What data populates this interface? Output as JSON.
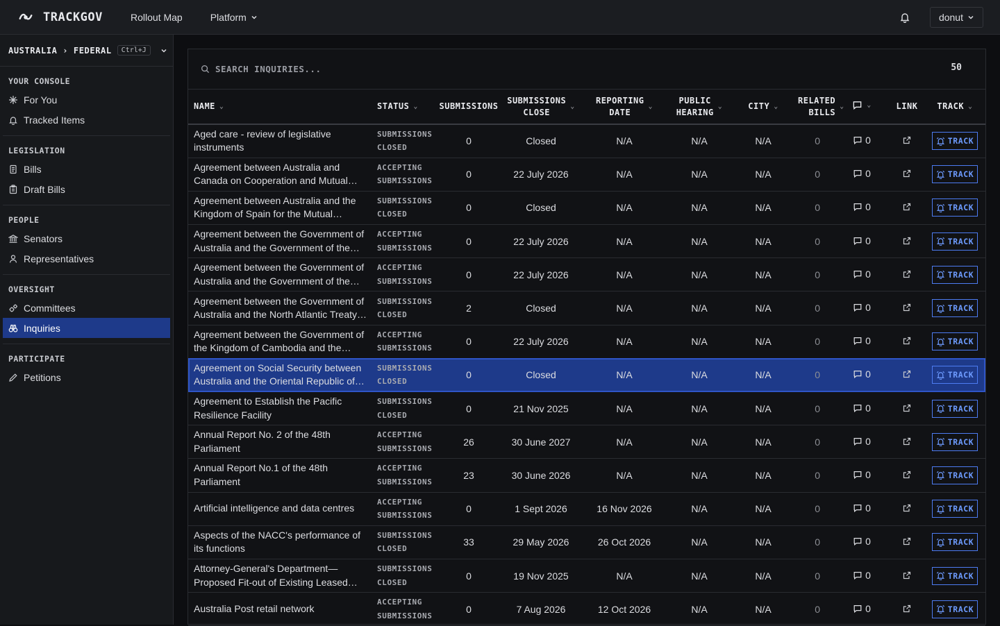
{
  "brand": "TRACKGOV",
  "nav": {
    "rollout_map": "Rollout Map",
    "platform": "Platform"
  },
  "user": "donut",
  "jurisdiction": {
    "label": "AUSTRALIA › FEDERAL",
    "shortcut": "Ctrl+J"
  },
  "sidebar": {
    "sections": [
      {
        "title": "YOUR CONSOLE",
        "items": [
          {
            "label": "For You",
            "icon": "sparkle-icon"
          },
          {
            "label": "Tracked Items",
            "icon": "bell-icon"
          }
        ]
      },
      {
        "title": "LEGISLATION",
        "items": [
          {
            "label": "Bills",
            "icon": "scroll-icon"
          },
          {
            "label": "Draft Bills",
            "icon": "clipboard-icon"
          }
        ]
      },
      {
        "title": "PEOPLE",
        "items": [
          {
            "label": "Senators",
            "icon": "landmark-icon"
          },
          {
            "label": "Representatives",
            "icon": "person-icon"
          }
        ]
      },
      {
        "title": "OVERSIGHT",
        "items": [
          {
            "label": "Committees",
            "icon": "cog-group-icon"
          },
          {
            "label": "Inquiries",
            "icon": "binoculars-icon",
            "active": true
          }
        ]
      },
      {
        "title": "PARTICIPATE",
        "items": [
          {
            "label": "Petitions",
            "icon": "pen-icon"
          }
        ]
      }
    ]
  },
  "search": {
    "placeholder": "SEARCH INQUIRIES...",
    "count": "50"
  },
  "columns": {
    "name": "NAME",
    "status": "STATUS",
    "submissions": "SUBMISSIONS",
    "submissions_close_1": "SUBMISSIONS",
    "submissions_close_2": "CLOSE",
    "reporting_date_1": "REPORTING",
    "reporting_date_2": "DATE",
    "public_hearing_1": "PUBLIC",
    "public_hearing_2": "HEARING",
    "city": "CITY",
    "related_bills_1": "RELATED",
    "related_bills_2": "BILLS",
    "link": "LINK",
    "track": "TRACK"
  },
  "track_label": "TRACK",
  "rows": [
    {
      "name": "Aged care - review of legislative instruments",
      "status1": "SUBMISSIONS",
      "status2": "CLOSED",
      "submissions": "0",
      "close": "Closed",
      "reporting": "N/A",
      "hearing": "N/A",
      "city": "N/A",
      "bills": "0",
      "comments": "0"
    },
    {
      "name": "Agreement between Australia and Canada on Cooperation and Mutual Assistance",
      "status1": "ACCEPTING",
      "status2": "SUBMISSIONS",
      "submissions": "0",
      "close": "22 July 2026",
      "reporting": "N/A",
      "hearing": "N/A",
      "city": "N/A",
      "bills": "0",
      "comments": "0"
    },
    {
      "name": "Agreement between Australia and the Kingdom of Spain for the Mutual Protection",
      "status1": "SUBMISSIONS",
      "status2": "CLOSED",
      "submissions": "0",
      "close": "Closed",
      "reporting": "N/A",
      "hearing": "N/A",
      "city": "N/A",
      "bills": "0",
      "comments": "0"
    },
    {
      "name": "Agreement between the Government of Australia and the Government of the Republic",
      "status1": "ACCEPTING",
      "status2": "SUBMISSIONS",
      "submissions": "0",
      "close": "22 July 2026",
      "reporting": "N/A",
      "hearing": "N/A",
      "city": "N/A",
      "bills": "0",
      "comments": "0"
    },
    {
      "name": "Agreement between the Government of Australia and the Government of the Republic",
      "status1": "ACCEPTING",
      "status2": "SUBMISSIONS",
      "submissions": "0",
      "close": "22 July 2026",
      "reporting": "N/A",
      "hearing": "N/A",
      "city": "N/A",
      "bills": "0",
      "comments": "0"
    },
    {
      "name": "Agreement between the Government of Australia and the North Atlantic Treaty Organization",
      "status1": "SUBMISSIONS",
      "status2": "CLOSED",
      "submissions": "2",
      "close": "Closed",
      "reporting": "N/A",
      "hearing": "N/A",
      "city": "N/A",
      "bills": "0",
      "comments": "0"
    },
    {
      "name": "Agreement between the Government of the Kingdom of Cambodia and the Government",
      "status1": "ACCEPTING",
      "status2": "SUBMISSIONS",
      "submissions": "0",
      "close": "22 July 2026",
      "reporting": "N/A",
      "hearing": "N/A",
      "city": "N/A",
      "bills": "0",
      "comments": "0"
    },
    {
      "name": "Agreement on Social Security between Australia and the Oriental Republic of Uruguay",
      "status1": "SUBMISSIONS",
      "status2": "CLOSED",
      "submissions": "0",
      "close": "Closed",
      "reporting": "N/A",
      "hearing": "N/A",
      "city": "N/A",
      "bills": "0",
      "comments": "0",
      "selected": true
    },
    {
      "name": "Agreement to Establish the Pacific Resilience Facility",
      "status1": "SUBMISSIONS",
      "status2": "CLOSED",
      "submissions": "0",
      "close": "21 Nov 2025",
      "reporting": "N/A",
      "hearing": "N/A",
      "city": "N/A",
      "bills": "0",
      "comments": "0"
    },
    {
      "name": "Annual Report No. 2 of the 48th Parliament",
      "status1": "ACCEPTING",
      "status2": "SUBMISSIONS",
      "submissions": "26",
      "close": "30 June 2027",
      "reporting": "N/A",
      "hearing": "N/A",
      "city": "N/A",
      "bills": "0",
      "comments": "0"
    },
    {
      "name": "Annual Report No.1 of the 48th Parliament",
      "status1": "ACCEPTING",
      "status2": "SUBMISSIONS",
      "submissions": "23",
      "close": "30 June 2026",
      "reporting": "N/A",
      "hearing": "N/A",
      "city": "N/A",
      "bills": "0",
      "comments": "0"
    },
    {
      "name": "Artificial intelligence and data centres",
      "status1": "ACCEPTING",
      "status2": "SUBMISSIONS",
      "submissions": "0",
      "close": "1 Sept 2026",
      "reporting": "16 Nov 2026",
      "hearing": "N/A",
      "city": "N/A",
      "bills": "0",
      "comments": "0"
    },
    {
      "name": "Aspects of the NACC's performance of its functions",
      "status1": "SUBMISSIONS",
      "status2": "CLOSED",
      "submissions": "33",
      "close": "29 May 2026",
      "reporting": "26 Oct 2026",
      "hearing": "N/A",
      "city": "N/A",
      "bills": "0",
      "comments": "0"
    },
    {
      "name": "Attorney-General's Department—Proposed Fit-out of Existing Leased Premises",
      "status1": "SUBMISSIONS",
      "status2": "CLOSED",
      "submissions": "0",
      "close": "19 Nov 2025",
      "reporting": "N/A",
      "hearing": "N/A",
      "city": "N/A",
      "bills": "0",
      "comments": "0"
    },
    {
      "name": "Australia Post retail network",
      "status1": "ACCEPTING",
      "status2": "SUBMISSIONS",
      "submissions": "0",
      "close": "7 Aug 2026",
      "reporting": "12 Oct 2026",
      "hearing": "N/A",
      "city": "N/A",
      "bills": "0",
      "comments": "0"
    }
  ]
}
